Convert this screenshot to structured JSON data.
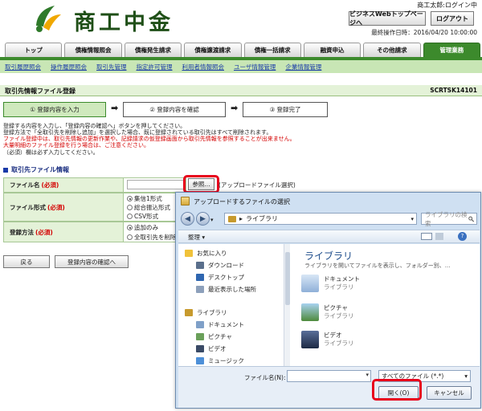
{
  "header": {
    "logo_text": "商工中金",
    "user_name": "商工太郎:ログイン中",
    "web_manual_label": "ビジネスWebトップページへ",
    "logout_label": "ログアウト",
    "last_operation": "最終操作日時：2016/04/20 10:00:00"
  },
  "tabs": [
    {
      "label": "トップ"
    },
    {
      "label": "債権情報照会"
    },
    {
      "label": "債権発生請求"
    },
    {
      "label": "債権譲渡請求"
    },
    {
      "label": "債権一括請求"
    },
    {
      "label": "融資申込"
    },
    {
      "label": "その他請求"
    },
    {
      "label": "管理業務"
    }
  ],
  "subnav": [
    {
      "label": "取引履歴照会"
    },
    {
      "label": "操作履歴照会"
    },
    {
      "label": "取引先管理"
    },
    {
      "label": "指定許可管理"
    },
    {
      "label": "利用者情報照会"
    },
    {
      "label": "ユーザ情報管理"
    },
    {
      "label": "企業情報管理"
    }
  ],
  "page": {
    "title": "取引先情報ファイル登録",
    "screen_id": "SCRTSK14101"
  },
  "steps": [
    {
      "label": "① 登録内容を入力"
    },
    {
      "label": "② 登録内容を確認"
    },
    {
      "label": "③ 登録完了"
    }
  ],
  "step_arrow": "➡",
  "messages": {
    "line1": "登録する内容を入力し、「登録内容の確認へ」ボタンを押してください。",
    "line2": "登録方法で「全取引先を削除し追加」を選択した場合、既に登録されている取引先はすべて削除されます。",
    "line3": "ファイル登録中は、取引先情報の更新作業や、記録請求の仮登録画面から取引先情報を参照することが出来ません。",
    "line4": "大量明細のファイル登録を行う場合は、ご注意ください。",
    "line5": "（必須）欄は必ず入力してください。"
  },
  "section": {
    "title": "取引先ファイル情報"
  },
  "form": {
    "file_name_label": "ファイル名",
    "file_format_label": "ファイル形式",
    "register_method_label": "登録方法",
    "required": "(必須)",
    "browse_label": "参照...",
    "browse_note": "(アップロードファイル選択)",
    "formats": [
      "集信1形式",
      "総合振込形式",
      "CSV形式"
    ],
    "methods": [
      "追加のみ",
      "全取引先を削除"
    ]
  },
  "buttons": {
    "back": "戻る",
    "confirm": "登録内容の確認へ"
  },
  "dialog": {
    "title": "アップロードするファイルの選択",
    "address": "ライブラリ",
    "address_arrow": "▸",
    "search_placeholder": "ライブラリの検索",
    "organize": "整理 ▾",
    "nav": {
      "favorites": "お気に入り",
      "downloads": "ダウンロード",
      "desktop": "デスクトップ",
      "recent": "最近表示した場所",
      "libraries": "ライブラリ",
      "documents": "ドキュメント",
      "pictures": "ピクチャ",
      "videos": "ビデオ",
      "music": "ミュージック"
    },
    "content": {
      "title": "ライブラリ",
      "subtitle": "ライブラリを開いてファイルを表示し、フォルダー別、...",
      "items": [
        {
          "name": "ドキュメント",
          "type": "ライブラリ"
        },
        {
          "name": "ピクチャ",
          "type": "ライブラリ"
        },
        {
          "name": "ビデオ",
          "type": "ライブラリ"
        }
      ]
    },
    "file_name_label": "ファイル名(N):",
    "filter": "すべてのファイル (*.*)",
    "open": "開く(O)",
    "cancel": "キャンセル"
  }
}
